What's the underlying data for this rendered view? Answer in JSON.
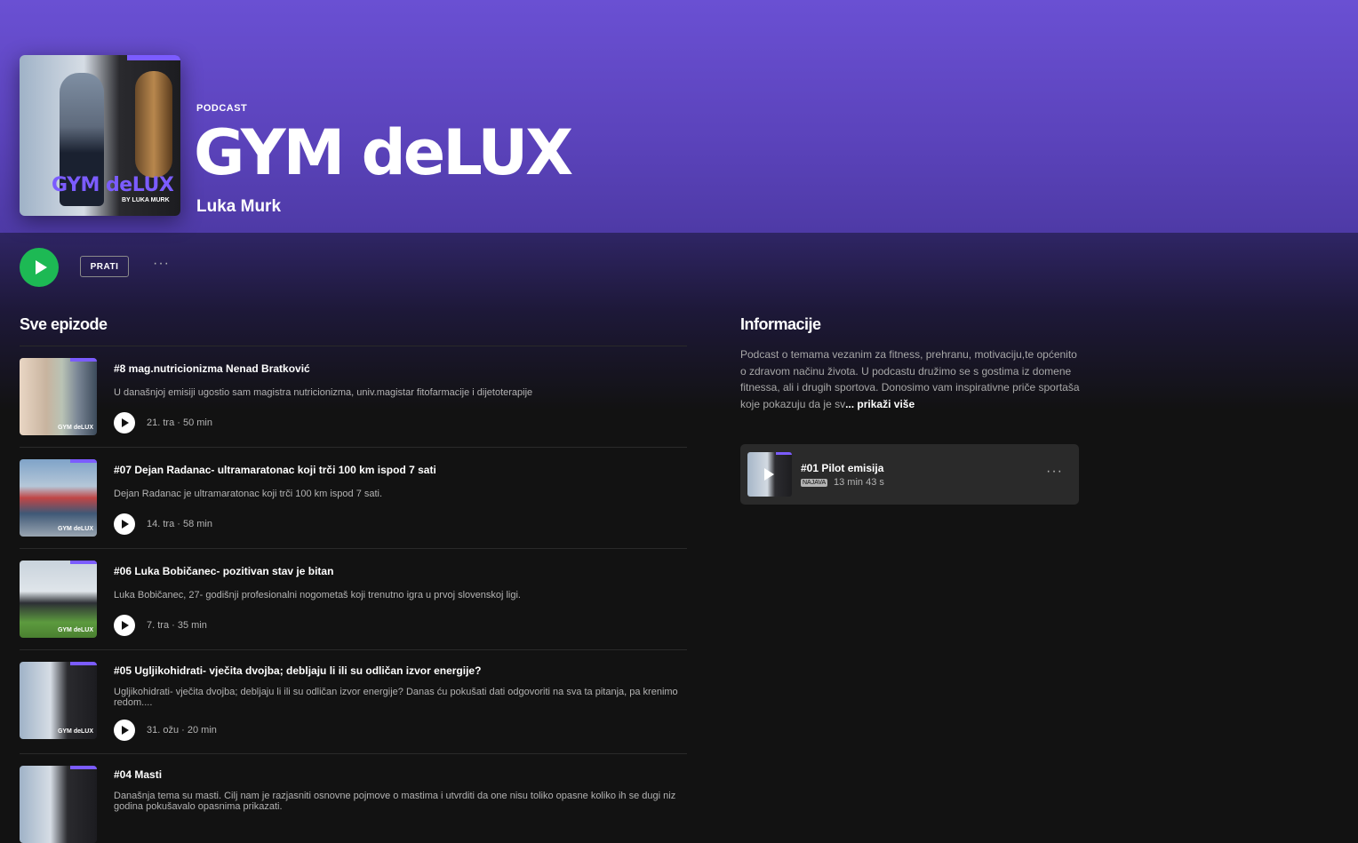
{
  "header": {
    "kicker": "PODCAST",
    "title": "GYM deLUX",
    "author": "Luka Murk",
    "cover": {
      "logo_text": "GYM deLUX",
      "byline": "BY LUKA MURK"
    }
  },
  "actions": {
    "follow_label": "PRATI",
    "more_label": "···"
  },
  "episodes_section": {
    "title": "Sve epizode",
    "items": [
      {
        "title": "#8 mag.nutricionizma Nenad Bratković",
        "description": "U današnjoj emisiji ugostio sam magistra nutricionizma, univ.magistar fitofarmacije i dijetoterapije",
        "meta": "21. tra · 50 min"
      },
      {
        "title": "#07 Dejan Radanac- ultramaratonac koji trči 100 km ispod 7 sati",
        "description": "Dejan Radanac je ultramaratonac koji trči 100 km ispod 7 sati.",
        "meta": "14. tra · 58 min"
      },
      {
        "title": "#06 Luka Bobičanec- pozitivan stav je bitan",
        "description": "Luka Bobičanec, 27- godišnji profesionalni nogometaš koji trenutno igra u prvoj slovenskoj ligi.",
        "meta": "7. tra · 35 min"
      },
      {
        "title": "#05 Ugljikohidrati- vječita dvojba; debljaju li ili su odličan izvor energije?",
        "description": "Ugljikohidrati- vječita dvojba; debljaju li ili su odličan izvor energije? Danas ću pokušati dati odgovoriti na sva ta pitanja, pa krenimo redom....",
        "meta": "31. ožu · 20 min"
      },
      {
        "title": "#04 Masti",
        "description": "Današnja tema su masti. Cilj nam je razjasniti osnovne pojmove o mastima i utvrditi da one nisu toliko opasne koliko ih se dugi niz godina pokušavalo opasnima prikazati.",
        "meta": ""
      }
    ]
  },
  "info_section": {
    "title": "Informacije",
    "about": "Podcast o temama vezanim za fitness, prehranu, motivaciju,te općenito o zdravom načinu života. U podcastu družimo se s gostima iz domene fitnessa, ali i drugih sportova. Donosimo vam inspirativne priče sportaša koje pokazuju da je sv",
    "show_more": "... prikaži više",
    "featured": {
      "title": "#01 Pilot emisija",
      "badge": "NAJAVA",
      "duration": "13 min 43 s",
      "more_label": "···"
    }
  },
  "colors": {
    "accent_green": "#1db954",
    "hero_purple": "#6a50d3",
    "brand_purple": "#7b5cff",
    "background": "#121212"
  },
  "icons": [
    "play-icon",
    "more-icon"
  ]
}
